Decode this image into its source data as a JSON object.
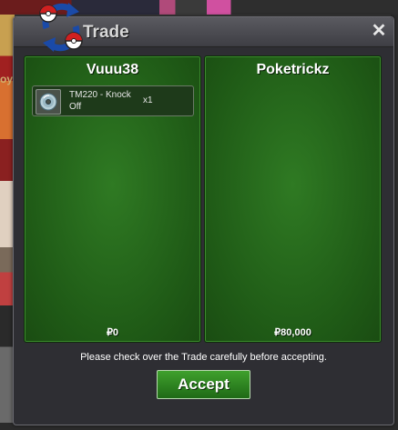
{
  "window": {
    "title": "Trade",
    "close_symbol": "✕"
  },
  "left_panel": {
    "player_name": "Vuuu38",
    "items": [
      {
        "name": "TM220 - Knock Off",
        "quantity": "x1",
        "icon": "disc-icon"
      }
    ],
    "money": "₽0"
  },
  "right_panel": {
    "player_name": "Poketrickz",
    "items": [],
    "money": "₽80,000"
  },
  "notice": "Please check over the Trade carefully before accepting.",
  "accept_label": "Accept",
  "background_edge_text": "oy",
  "colors": {
    "panel_green": "#2f7a23",
    "window_bg": "#2e2e33",
    "accept_green": "#3fa02d"
  }
}
